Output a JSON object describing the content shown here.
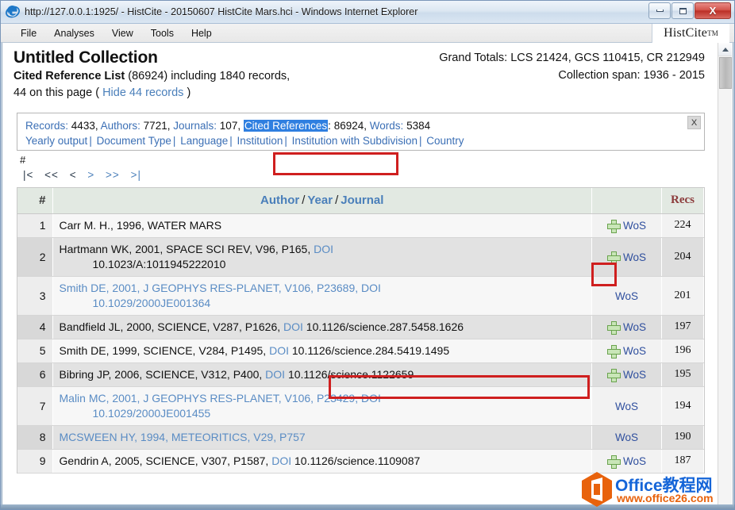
{
  "window": {
    "title": "http://127.0.0.1:1925/ - HistCite - 20150607 HistCite Mars.hci - Windows Internet Explorer",
    "minimize_label": "",
    "maximize_label": "",
    "close_label": "X"
  },
  "menu": {
    "items": [
      {
        "label": "File"
      },
      {
        "label": "Analyses"
      },
      {
        "label": "View"
      },
      {
        "label": "Tools"
      },
      {
        "label": "Help"
      }
    ],
    "logo": "HistCite",
    "logo_sup": "TM"
  },
  "header": {
    "collection_title": "Untitled Collection",
    "list_title": "Cited Reference List",
    "list_count": "(86924)",
    "including_text": "including 1840 records,",
    "page_count_text": "44 on this page (",
    "hide_link": "Hide 44 records",
    "page_count_close": ")",
    "grand_totals": "Grand Totals: LCS 21424, GCS 110415, CR 212949",
    "collection_span": "Collection span: 1936 - 2015"
  },
  "infobox": {
    "records_label": "Records:",
    "records_value": "4433",
    "authors_label": "Authors:",
    "authors_value": "7721",
    "journals_label": "Journals:",
    "journals_value": "107",
    "cited_refs_label": "Cited References",
    "cited_refs_value": "86924",
    "words_label": "Words:",
    "words_value": "5384",
    "links": [
      {
        "label": "Yearly output"
      },
      {
        "label": "Document Type"
      },
      {
        "label": "Language"
      },
      {
        "label": "Institution"
      },
      {
        "label": "Institution with Subdivision"
      },
      {
        "label": "Country"
      }
    ],
    "close_label": "X"
  },
  "pager": {
    "hash": "#",
    "first": "|<",
    "prev_block": "<<",
    "prev": "<",
    "next": ">",
    "next_block": ">>",
    "last": ">|"
  },
  "table": {
    "headers": {
      "num": "#",
      "author": "Author",
      "year": "Year",
      "journal": "Journal",
      "wos": "",
      "recs": "Recs"
    },
    "rows": [
      {
        "num": "1",
        "ref_main": "Carr M. H., 1996, WATER MARS",
        "ref_doi_label": "",
        "ref_doi_value": "",
        "all_link": false,
        "has_plus": true,
        "wos": "WoS",
        "recs": "224"
      },
      {
        "num": "2",
        "ref_main": "Hartmann WK, 2001, SPACE SCI REV, V96, P165,",
        "ref_doi_label": "DOI",
        "ref_doi_value": "10.1023/A:1011945222010",
        "all_link": false,
        "has_plus": true,
        "wos": "WoS",
        "recs": "204"
      },
      {
        "num": "3",
        "ref_main": "Smith DE, 2001, J GEOPHYS RES-PLANET, V106, P23689,",
        "ref_doi_label": "DOI",
        "ref_doi_value": "10.1029/2000JE001364",
        "all_link": true,
        "has_plus": false,
        "wos": "WoS",
        "recs": "201"
      },
      {
        "num": "4",
        "ref_main": "Bandfield JL, 2000, SCIENCE, V287, P1626,",
        "ref_doi_label": "DOI",
        "ref_doi_value": "10.1126/science.287.5458.1626",
        "all_link": false,
        "has_plus": true,
        "wos": "WoS",
        "recs": "197"
      },
      {
        "num": "5",
        "ref_main": "Smith DE, 1999, SCIENCE, V284, P1495,",
        "ref_doi_label": "DOI",
        "ref_doi_value": "10.1126/science.284.5419.1495",
        "all_link": false,
        "has_plus": true,
        "wos": "WoS",
        "recs": "196"
      },
      {
        "num": "6",
        "ref_main": "Bibring JP, 2006, SCIENCE, V312, P400,",
        "ref_doi_label": "DOI",
        "ref_doi_value": "10.1126/science.1122659",
        "all_link": false,
        "has_plus": true,
        "wos": "WoS",
        "recs": "195"
      },
      {
        "num": "7",
        "ref_main": "Malin MC, 2001, J GEOPHYS RES-PLANET, V106, P23429,",
        "ref_doi_label": "DOI",
        "ref_doi_value": "10.1029/2000JE001455",
        "all_link": true,
        "has_plus": false,
        "wos": "WoS",
        "recs": "194"
      },
      {
        "num": "8",
        "ref_main": "MCSWEEN HY, 1994, METEORITICS, V29, P757",
        "ref_doi_label": "",
        "ref_doi_value": "",
        "all_link": true,
        "has_plus": false,
        "wos": "WoS",
        "recs": "190"
      },
      {
        "num": "9",
        "ref_main": "Gendrin A, 2005, SCIENCE, V307, P1587,",
        "ref_doi_label": "DOI",
        "ref_doi_value": "10.1126/science.1109087",
        "all_link": false,
        "has_plus": true,
        "wos": "WoS",
        "recs": "187"
      }
    ]
  },
  "watermark": {
    "text_main": "Office教程网",
    "text_sub": "www.office26.com"
  },
  "colors": {
    "accent_link": "#3b6fb5",
    "selection": "#2f7fe0",
    "annotation": "#cf1f1f",
    "recs": "#8c3b3b",
    "plus_green": "#6aa34e"
  }
}
